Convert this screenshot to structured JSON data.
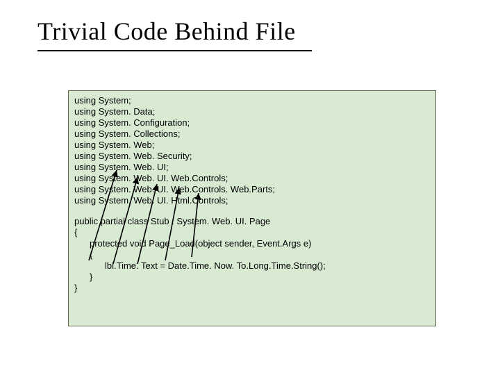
{
  "title": "Trivial Code Behind File",
  "code": {
    "usings": [
      "using System;",
      "using System. Data;",
      "using System. Configuration;",
      "using System. Collections;",
      "using System. Web;",
      "using System. Web. Security;",
      "using System. Web. UI;",
      "using System. Web. UI. Web.Controls;",
      "using System. Web. UI. Web.Controls. Web.Parts;",
      "using System. Web. UI. Html.Controls;"
    ],
    "class_decl": "public partial class Stub : System. Web. UI. Page",
    "open_brace": "{",
    "method_sig": "protected void Page_Load(object sender, Event.Args e)",
    "method_open": "{",
    "method_body": "lbl.Time. Text = Date.Time. Now. To.Long.Time.String();",
    "method_close": "}",
    "close_brace": "}"
  }
}
